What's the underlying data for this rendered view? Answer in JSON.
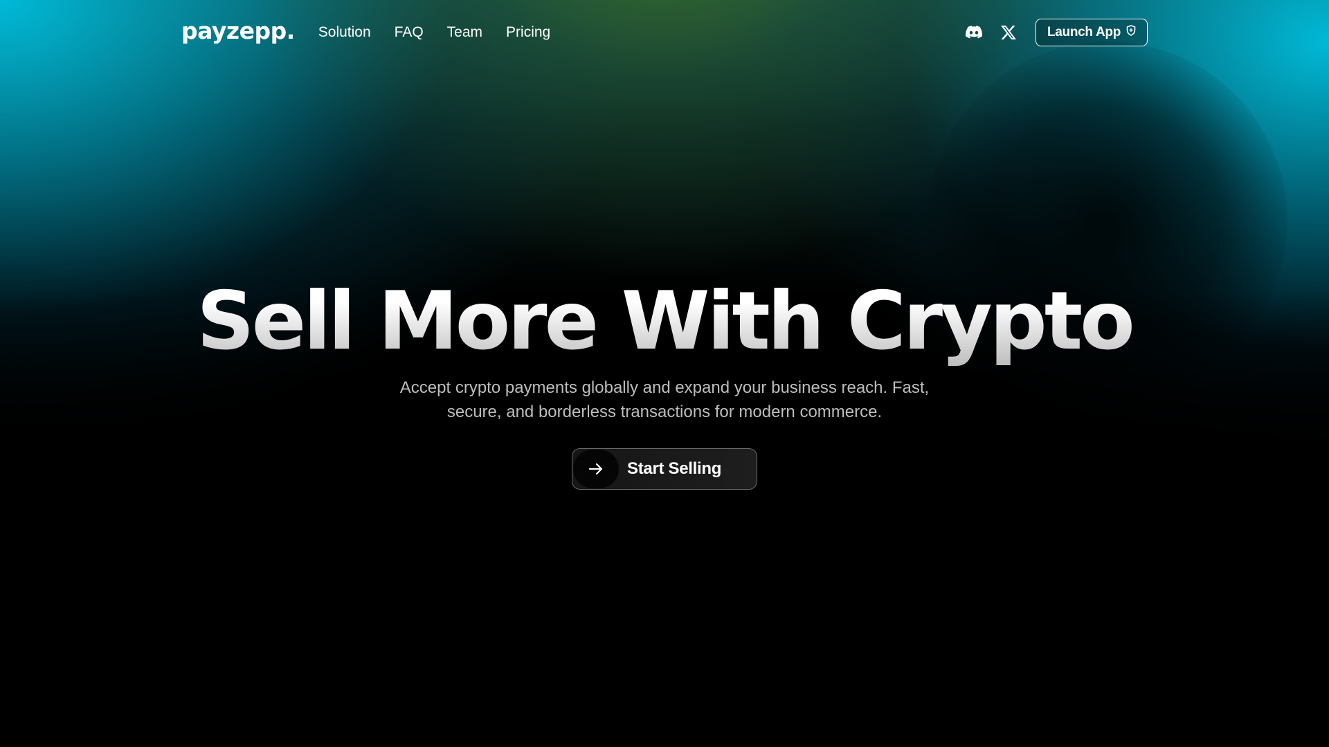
{
  "brand": {
    "logo_text": "payzepp."
  },
  "nav": {
    "links": [
      {
        "label": "Solution"
      },
      {
        "label": "FAQ"
      },
      {
        "label": "Team"
      },
      {
        "label": "Pricing"
      }
    ],
    "social": [
      {
        "icon": "discord-icon"
      },
      {
        "icon": "x-twitter-icon"
      }
    ],
    "launch_button": {
      "label": "Launch App",
      "icon": "shield-icon"
    }
  },
  "hero": {
    "title": "Sell More With Crypto",
    "subtitle_line1": "Accept crypto payments globally and expand your business reach. Fast,",
    "subtitle_line2": "secure, and borderless transactions for modern commerce.",
    "cta": {
      "label": "Start Selling",
      "icon": "arrow-right-icon"
    }
  },
  "colors": {
    "background": "#000000",
    "accent_cyan": "#00B9D7",
    "accent_green": "#3C6E28",
    "text_primary": "#FFFFFF",
    "text_muted": "#BDBDBD"
  }
}
